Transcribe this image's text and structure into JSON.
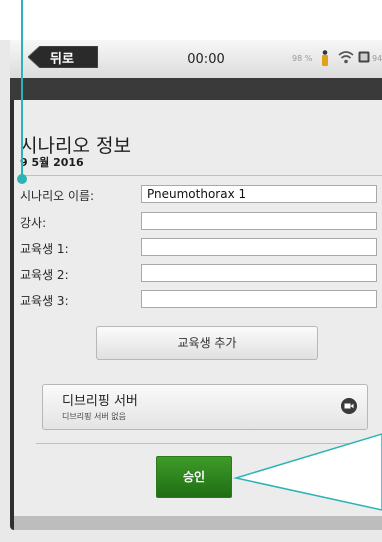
{
  "statusbar": {
    "back_label": "뒤로",
    "time": "00:00",
    "battery_left": "98 %",
    "battery_right": "94"
  },
  "scenario": {
    "title": "시나리오 정보",
    "date": "9 5월 2016"
  },
  "form": {
    "fields": [
      {
        "label": "시나리오 이름:",
        "value": "Pneumothorax 1"
      },
      {
        "label": "강사:",
        "value": ""
      },
      {
        "label": "교육생 1:",
        "value": ""
      },
      {
        "label": "교육생 2:",
        "value": ""
      },
      {
        "label": "교육생 3:",
        "value": ""
      }
    ],
    "add_trainee_label": "교육생 추가"
  },
  "debrief": {
    "title": "디브리핑 서버",
    "subtitle": "디브리핑 서버 없음"
  },
  "approve_label": "승인",
  "colors": {
    "callout": "#2bb3b5",
    "approve_green": "#2f8a20",
    "back_button": "#2f2f2f"
  }
}
